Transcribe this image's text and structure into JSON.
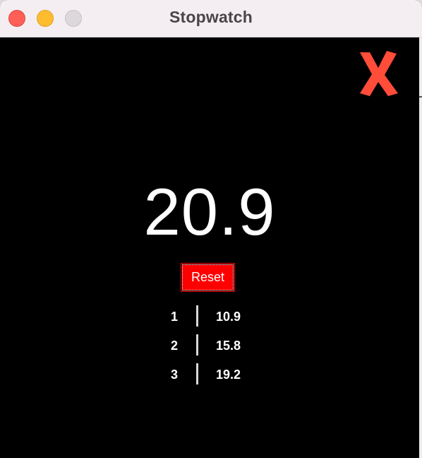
{
  "window": {
    "title": "Stopwatch"
  },
  "controls": {
    "close_icon": "close-x-icon",
    "close_color": "#ff4d3a",
    "reset_label": "Reset",
    "reset_color": "#ff0000"
  },
  "display": {
    "time": "20.9"
  },
  "laps": [
    {
      "number": "1",
      "time": "10.9"
    },
    {
      "number": "2",
      "time": "15.8"
    },
    {
      "number": "3",
      "time": "19.2"
    }
  ]
}
